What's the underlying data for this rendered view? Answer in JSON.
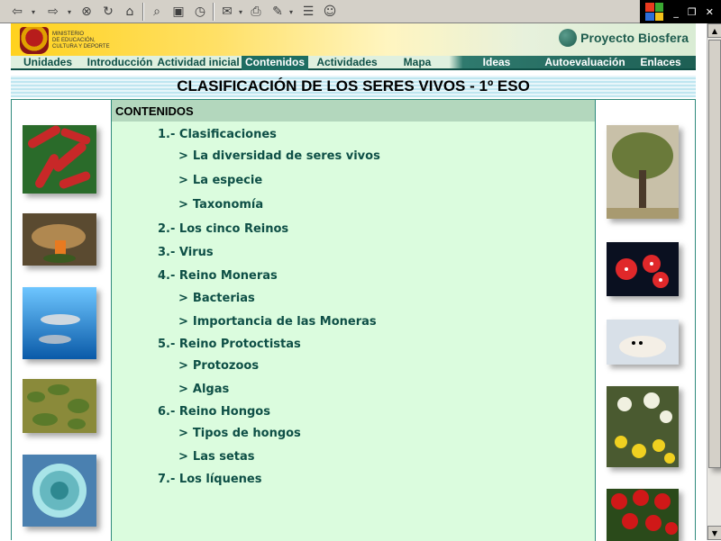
{
  "browser": {
    "toolbar_icons": [
      "back-icon",
      "forward-icon",
      "stop-icon",
      "refresh-icon",
      "home-icon",
      "search-icon",
      "favorites-icon",
      "history-icon",
      "mail-icon",
      "print-icon",
      "edit-icon",
      "discuss-icon",
      "messenger-icon"
    ],
    "window_controls": [
      "minimize",
      "restore",
      "close"
    ]
  },
  "site": {
    "ministry_lines": [
      "MINISTERIO",
      "DE EDUCACIÓN,",
      "CULTURA Y DEPORTE"
    ],
    "project_title": "Proyecto Biosfera"
  },
  "nav": {
    "items": [
      {
        "label": "Unidades"
      },
      {
        "label": "Introducción"
      },
      {
        "label": "Actividad inicial"
      },
      {
        "label": "Contenidos"
      },
      {
        "label": "Actividades"
      },
      {
        "label": "Mapa"
      },
      {
        "label": "Ideas"
      },
      {
        "label": "Autoevaluación"
      },
      {
        "label": "Enlaces"
      }
    ],
    "active": "Contenidos"
  },
  "page": {
    "title": "CLASIFICACIÓN DE LOS SERES VIVOS - 1º ESO",
    "section_header": "CONTENIDOS"
  },
  "toc": [
    {
      "text": "1.- Clasificaciones"
    },
    {
      "text": "La diversidad de seres vivos"
    },
    {
      "text": "La especie"
    },
    {
      "text": "Taxonomía"
    },
    {
      "text": "2.- Los cinco Reinos"
    },
    {
      "text": "3.- Virus"
    },
    {
      "text": "4.- Reino Moneras"
    },
    {
      "text": "Bacterias"
    },
    {
      "text": "Importancia de las Moneras"
    },
    {
      "text": "5.- Reino Protoctistas"
    },
    {
      "text": "Protozoos"
    },
    {
      "text": "Algas"
    },
    {
      "text": "6.- Reino Hongos"
    },
    {
      "text": "Tipos de hongos"
    },
    {
      "text": "Las setas"
    },
    {
      "text": "7.- Los líquenes"
    }
  ],
  "chevron": ">",
  "colors": {
    "accent": "#0e4f46",
    "content_bg": "#dbfcde",
    "header_bg": "#b3d7bd",
    "nav_active": "#1d6d62"
  }
}
